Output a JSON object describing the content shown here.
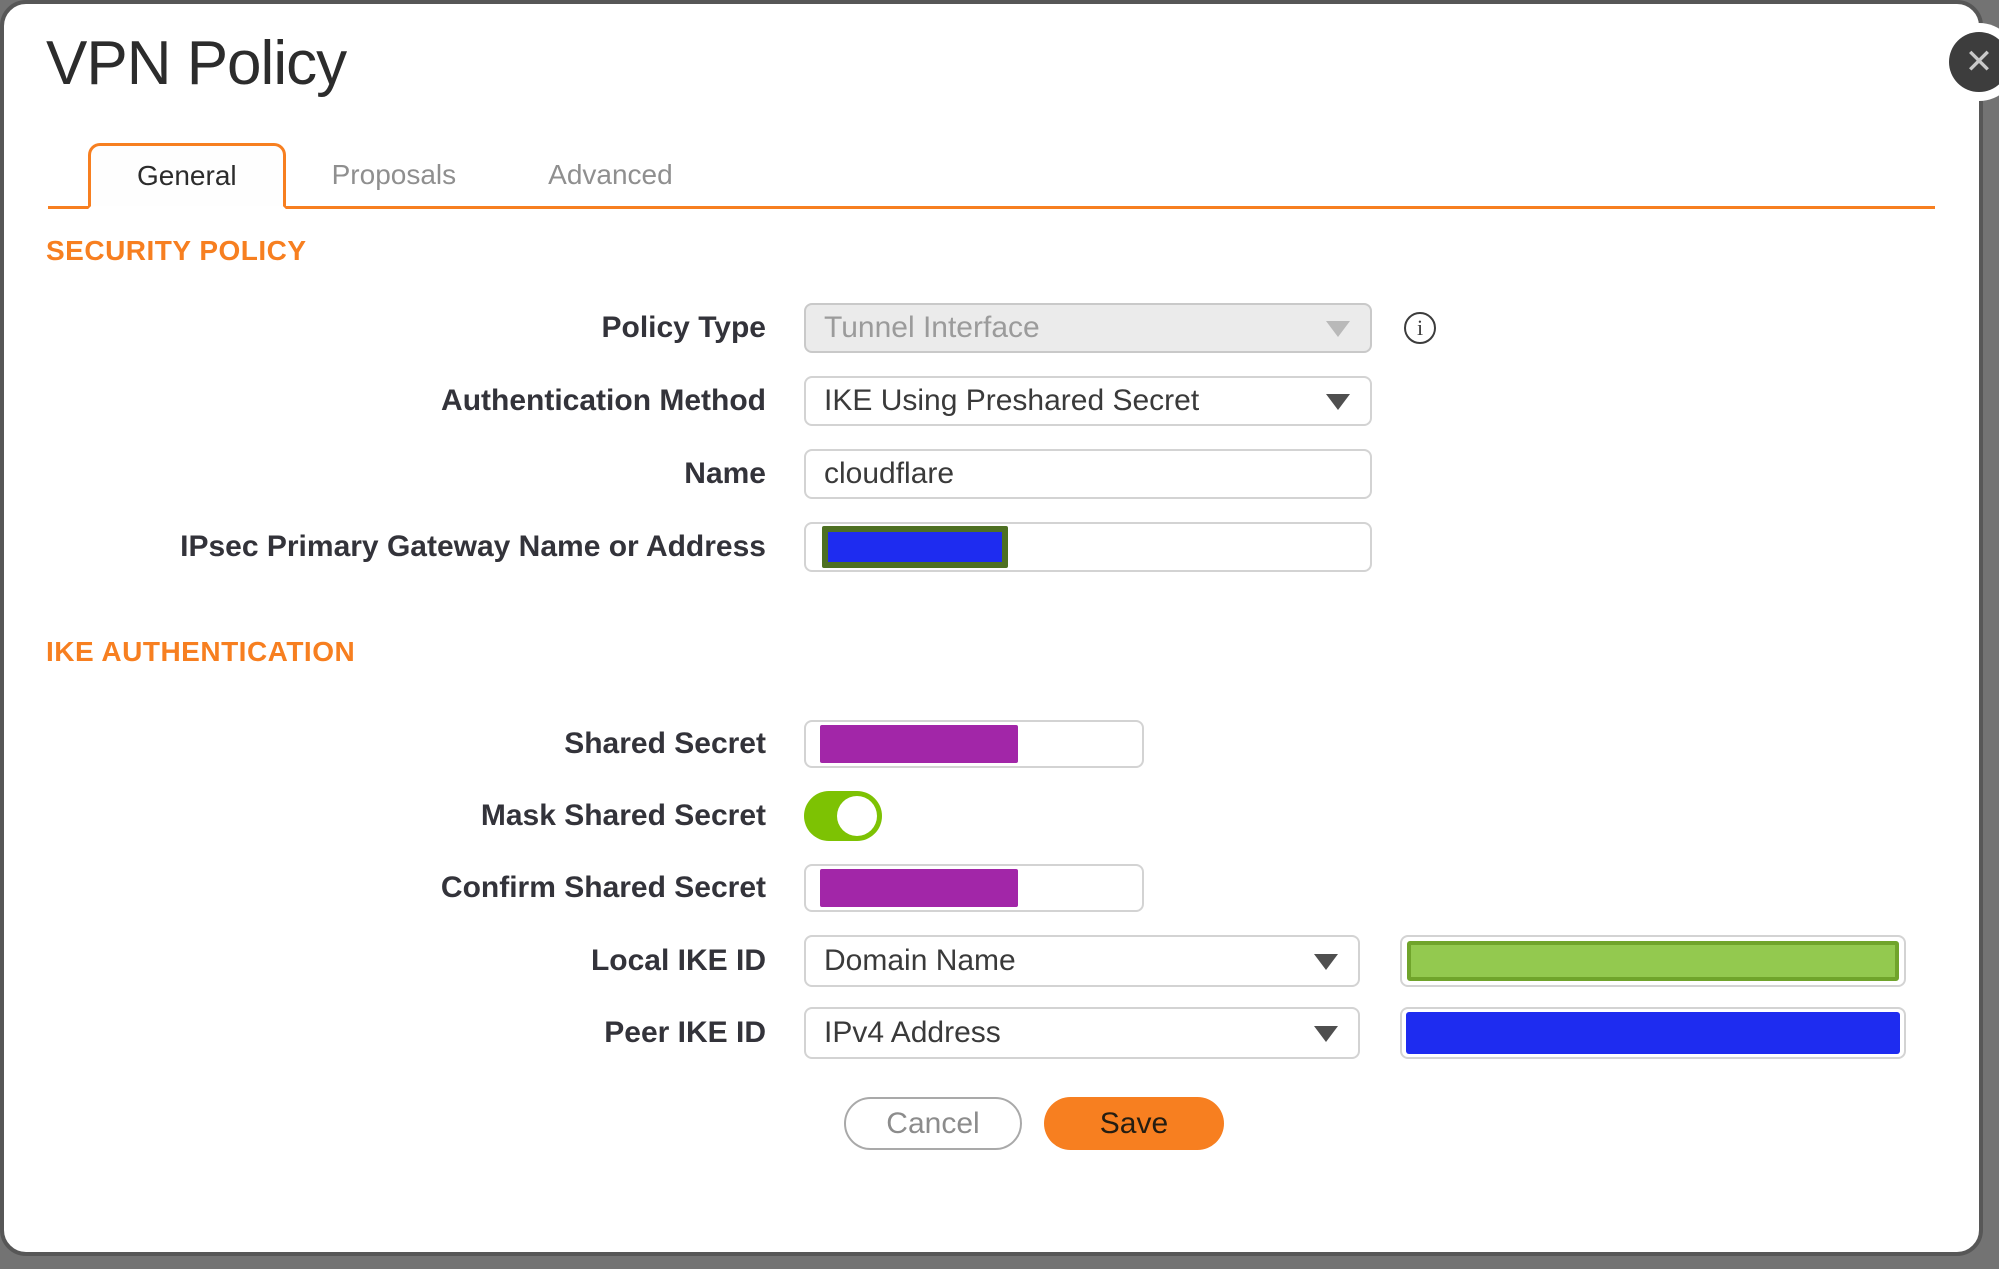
{
  "dialog": {
    "title": "VPN Policy"
  },
  "icons": {
    "close": "✕",
    "info": "i"
  },
  "tabs": [
    {
      "label": "General",
      "active": true
    },
    {
      "label": "Proposals",
      "active": false
    },
    {
      "label": "Advanced",
      "active": false
    }
  ],
  "sections": {
    "security_policy": "SECURITY POLICY",
    "ike_authentication": "IKE AUTHENTICATION"
  },
  "fields": {
    "policy_type": {
      "label": "Policy Type",
      "value": "Tunnel Interface",
      "disabled": true
    },
    "auth_method": {
      "label": "Authentication Method",
      "value": "IKE Using Preshared Secret"
    },
    "name": {
      "label": "Name",
      "value": "cloudflare"
    },
    "gateway": {
      "label": "IPsec Primary Gateway Name or Address",
      "value_redacted_color": "#1e2cf0",
      "value_redacted_border": "#4e7022"
    },
    "shared_secret": {
      "label": "Shared Secret",
      "value_redacted_color": "#a226a8"
    },
    "mask_shared_secret": {
      "label": "Mask Shared Secret",
      "state": "on",
      "toggle_color": "#7dc203"
    },
    "confirm_shared_secret": {
      "label": "Confirm Shared Secret",
      "value_redacted_color": "#a226a8"
    },
    "local_ike_id": {
      "label": "Local IKE ID",
      "type_value": "Domain Name",
      "id_redacted_color": "#93c94f",
      "id_redacted_border": "#70a42b"
    },
    "peer_ike_id": {
      "label": "Peer IKE ID",
      "type_value": "IPv4 Address",
      "id_redacted_color": "#1e2cf0"
    }
  },
  "buttons": {
    "cancel": "Cancel",
    "save": "Save"
  },
  "colors": {
    "accent_orange": "#f77f20",
    "backdrop_grey": "#737373",
    "redaction_purple": "#a226a8",
    "redaction_blue": "#1e2cf0",
    "redaction_green_fill": "#93c94f",
    "redaction_green_border": "#70a42b",
    "toggle_green": "#7dc203"
  }
}
